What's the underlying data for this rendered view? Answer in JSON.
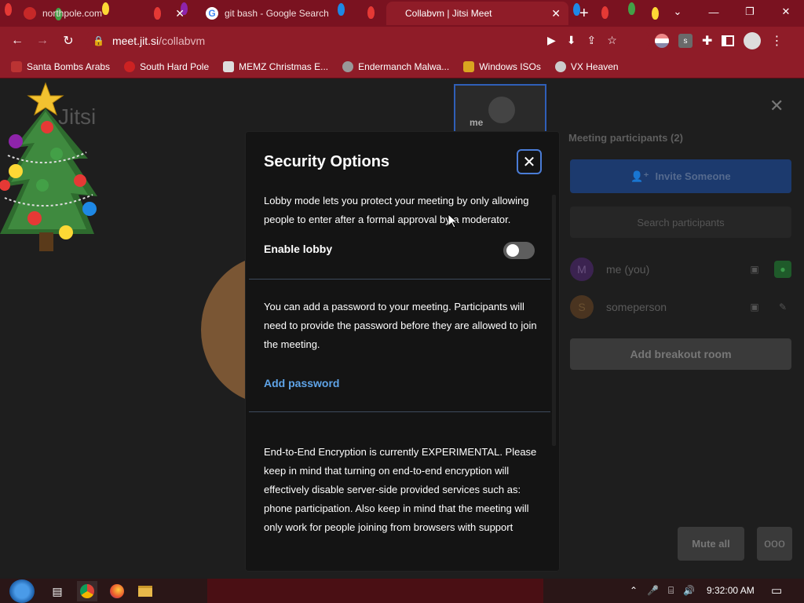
{
  "browser": {
    "tabs": [
      {
        "title": "northpole.com",
        "active": false
      },
      {
        "title": "git bash - Google Search",
        "active": false
      },
      {
        "title": "Collabvm | Jitsi Meet",
        "active": true
      }
    ],
    "new_tab_glyph": "+",
    "url": "meet.jit.si/collabvm",
    "url_host": "meet.jit.si",
    "url_path": "/collabvm",
    "bookmarks": [
      {
        "label": "Santa Bombs Arabs",
        "icon": "santa-icon",
        "color": "#b33"
      },
      {
        "label": "South Hard Pole",
        "icon": "snowflake-icon",
        "color": "#c22"
      },
      {
        "label": "MEMZ Christmas E...",
        "icon": "page-icon",
        "color": "#ddd"
      },
      {
        "label": "Endermanch Malwa...",
        "icon": "raccoon-icon",
        "color": "#999"
      },
      {
        "label": "Windows ISOs",
        "icon": "trophy-icon",
        "color": "#d9a520"
      },
      {
        "label": "VX Heaven",
        "icon": "skull-icon",
        "color": "#ccc"
      }
    ]
  },
  "meeting": {
    "logo_text": "Jitsi",
    "thumbnail_name": "me",
    "panel": {
      "title": "Meeting participants (2)",
      "invite_label": "Invite Someone",
      "search_placeholder": "Search participants",
      "participants": [
        {
          "initial": "M",
          "name": "me (you)",
          "color": "#5b2a86"
        },
        {
          "initial": "S",
          "name": "someperson",
          "color": "#7a5634"
        }
      ],
      "breakout_label": "Add breakout room",
      "mute_all_label": "Mute all",
      "more_label": "ooo"
    }
  },
  "dialog": {
    "title": "Security Options",
    "lobby_text": "Lobby mode lets you protect your meeting by only allowing people to enter after a formal approval by a moderator.",
    "lobby_label": "Enable lobby",
    "lobby_enabled": false,
    "password_text": "You can add a password to your meeting. Participants will need to provide the password before they are allowed to join the meeting.",
    "add_password_label": "Add password",
    "e2ee_text": "End-to-End Encryption is currently EXPERIMENTAL. Please keep in mind that turning on end-to-end encryption will effectively disable server-side provided services such as: phone participation. Also keep in mind that the meeting will only work for people joining from browsers with support"
  },
  "taskbar": {
    "time": "9:32:00 AM"
  },
  "colors": {
    "chrome": "#8f1c28",
    "accent_blue": "#5fa4e8",
    "dialog_bg": "#141414"
  }
}
